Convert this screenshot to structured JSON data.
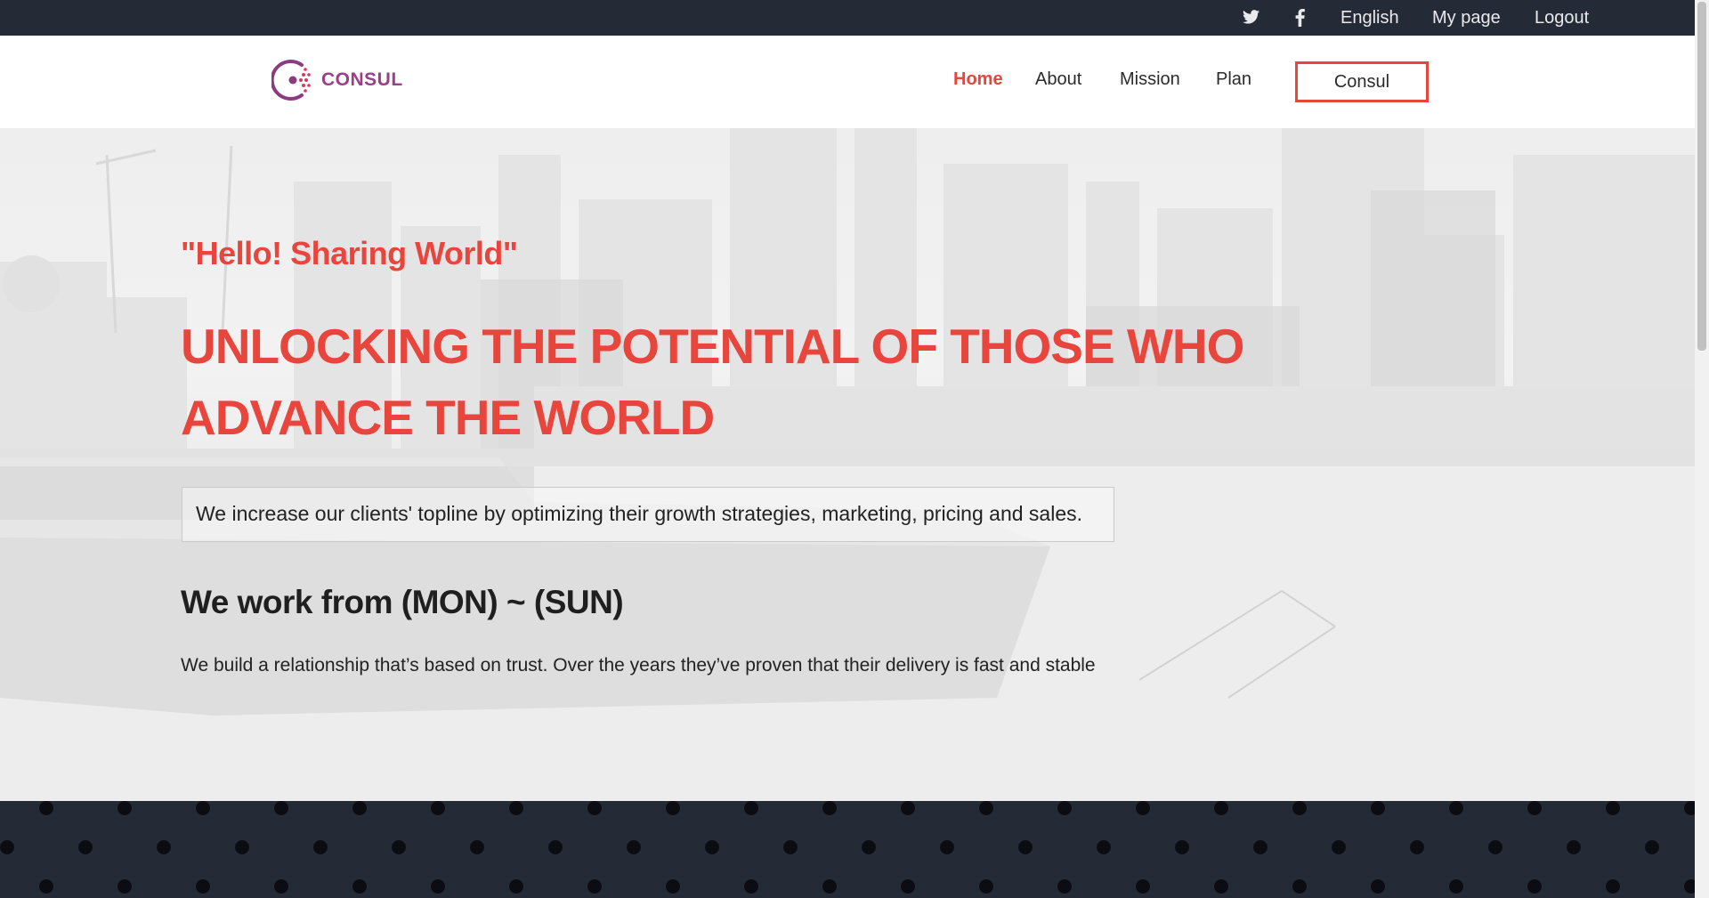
{
  "topbar": {
    "twitter_icon": "twitter-icon",
    "facebook_icon": "facebook-icon",
    "language": "English",
    "my_page": "My page",
    "logout": "Logout"
  },
  "brand": {
    "name": "CONSUL"
  },
  "nav": {
    "home": "Home",
    "about": "About",
    "mission": "Mission",
    "plan": "Plan",
    "cta": "Consul"
  },
  "hero": {
    "quote": "\"Hello! Sharing World\"",
    "title": "UNLOCKING THE POTENTIAL OF THOSE WHO ADVANCE THE WORLD",
    "tagline": "We increase our clients' topline by optimizing their growth strategies, marketing, pricing and sales.",
    "schedule": "We work from (MON) ~ (SUN)",
    "description": "We build a relationship that’s based on trust. Over the years they’ve proven that their delivery is fast and stable"
  },
  "colors": {
    "accent": "#e8453c",
    "dark": "#252a37",
    "brand": "#9a3f88"
  }
}
